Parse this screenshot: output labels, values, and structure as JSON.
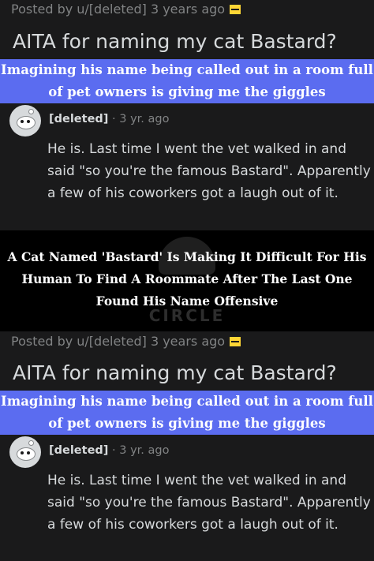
{
  "post": {
    "posted_by": "Posted by u/[deleted] 3 years ago",
    "title": "AITA for naming my cat Bastard?",
    "caption": "Imagining his name being called out in a room full of pet owners is giving me the giggles",
    "comment": {
      "user": "[deleted]",
      "age": "· 3 yr. ago",
      "text": "He is. Last time I went the vet walked in and said \"so you're the famous Bastard\". Apparently a few of his coworkers got a laugh out of it."
    }
  },
  "overlay": {
    "headline": "A Cat Named 'Bastard' Is Making It Difficult For His Human To Find A Roommate After The Last One Found His Name Offensive",
    "watermark": "CIRCLE"
  },
  "colors": {
    "background": "#1a1a1b",
    "banner": "#5b6cf0",
    "award": "#ffd635",
    "text": "#d7dadc",
    "muted": "#818384"
  }
}
